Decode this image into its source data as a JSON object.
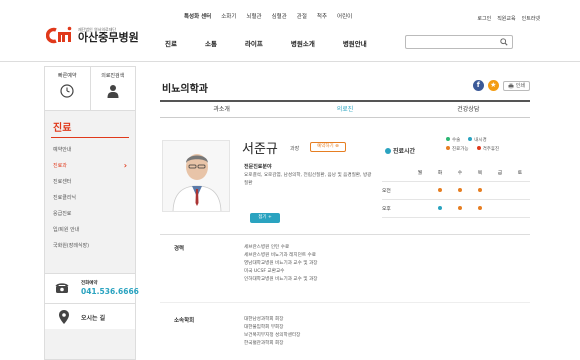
{
  "header": {
    "logo_sub": "재단법인 영서의료재단",
    "logo_main": "아산중무병원",
    "topnav": [
      "특성화 센터",
      "소화기",
      "뇌혈관",
      "심혈관",
      "관절",
      "척추",
      "어린이"
    ],
    "utility": [
      "로그인",
      "직원교육",
      "인트라넷"
    ],
    "mainnav": [
      "진료",
      "소통",
      "라이프",
      "병원소개",
      "병원안내"
    ],
    "search_placeholder": ""
  },
  "sidebar": {
    "quick": [
      {
        "label": "빠른예약",
        "icon": "clock-icon"
      },
      {
        "label": "의료진검색",
        "icon": "doctor-icon"
      }
    ],
    "title": "진료",
    "items": [
      {
        "label": "예약안내",
        "active": false
      },
      {
        "label": "진료과",
        "active": true
      },
      {
        "label": "진료센터",
        "active": false
      },
      {
        "label": "진료클리닉",
        "active": false
      },
      {
        "label": "응급진료",
        "active": false
      },
      {
        "label": "입/퇴원 안내",
        "active": false
      },
      {
        "label": "국화원(장례식장)",
        "active": false
      }
    ],
    "phone_label": "전화예약",
    "phone_number": "041.536.6666",
    "map_label": "오시는 길"
  },
  "content": {
    "title": "비뇨의학과",
    "print_label": "인쇄",
    "tabs": [
      {
        "label": "과소개",
        "active": false
      },
      {
        "label": "의료진",
        "active": true
      },
      {
        "label": "건강상담",
        "active": false
      }
    ],
    "doctor": {
      "name": "서준규",
      "title": "과장",
      "reserve_label": "예약하기",
      "spec_heading": "전문진료분야",
      "spec_text": "요로결석, 요로감염, 남성의학, 전립선질환, 음낭 및 음경질환, 방광질환",
      "more_label": "접기"
    },
    "schedule": {
      "title": "진료시간",
      "legend": [
        {
          "label": "수술",
          "color": "#2bb673"
        },
        {
          "label": "내시경",
          "color": "#2aa3c0"
        },
        {
          "label": "진료가능",
          "color": "#e67e22"
        },
        {
          "label": "격주휴진",
          "color": "#e0391b"
        }
      ],
      "days": [
        "월",
        "화",
        "수",
        "목",
        "금",
        "토"
      ],
      "rows": [
        {
          "label": "오전",
          "cells": [
            "",
            "진료가능",
            "진료가능",
            "진료가능",
            "",
            ""
          ]
        },
        {
          "label": "오후",
          "cells": [
            "",
            "내시경",
            "진료가능",
            "진료가능",
            "",
            ""
          ]
        }
      ]
    },
    "career_label": "경력",
    "career": [
      "세브란스병원 인턴 수료",
      "세브란스병원 비뇨기과 레지던트 수료",
      "영남대학교병원 비뇨기과 교수 및 과장",
      "미국 UCSF 교환교수",
      "인하대학교병원 비뇨기과 교수 및 과장"
    ],
    "society_label": "소속학회",
    "society": [
      "대한남성과학회 회장",
      "대한불임학회 부회장",
      "보건복지부지정 성의학센터장",
      "한국혈관과학회 회장"
    ]
  },
  "colors": {
    "brand": "#e0391b",
    "accent": "#2aa3c0",
    "orange": "#e67e22"
  }
}
